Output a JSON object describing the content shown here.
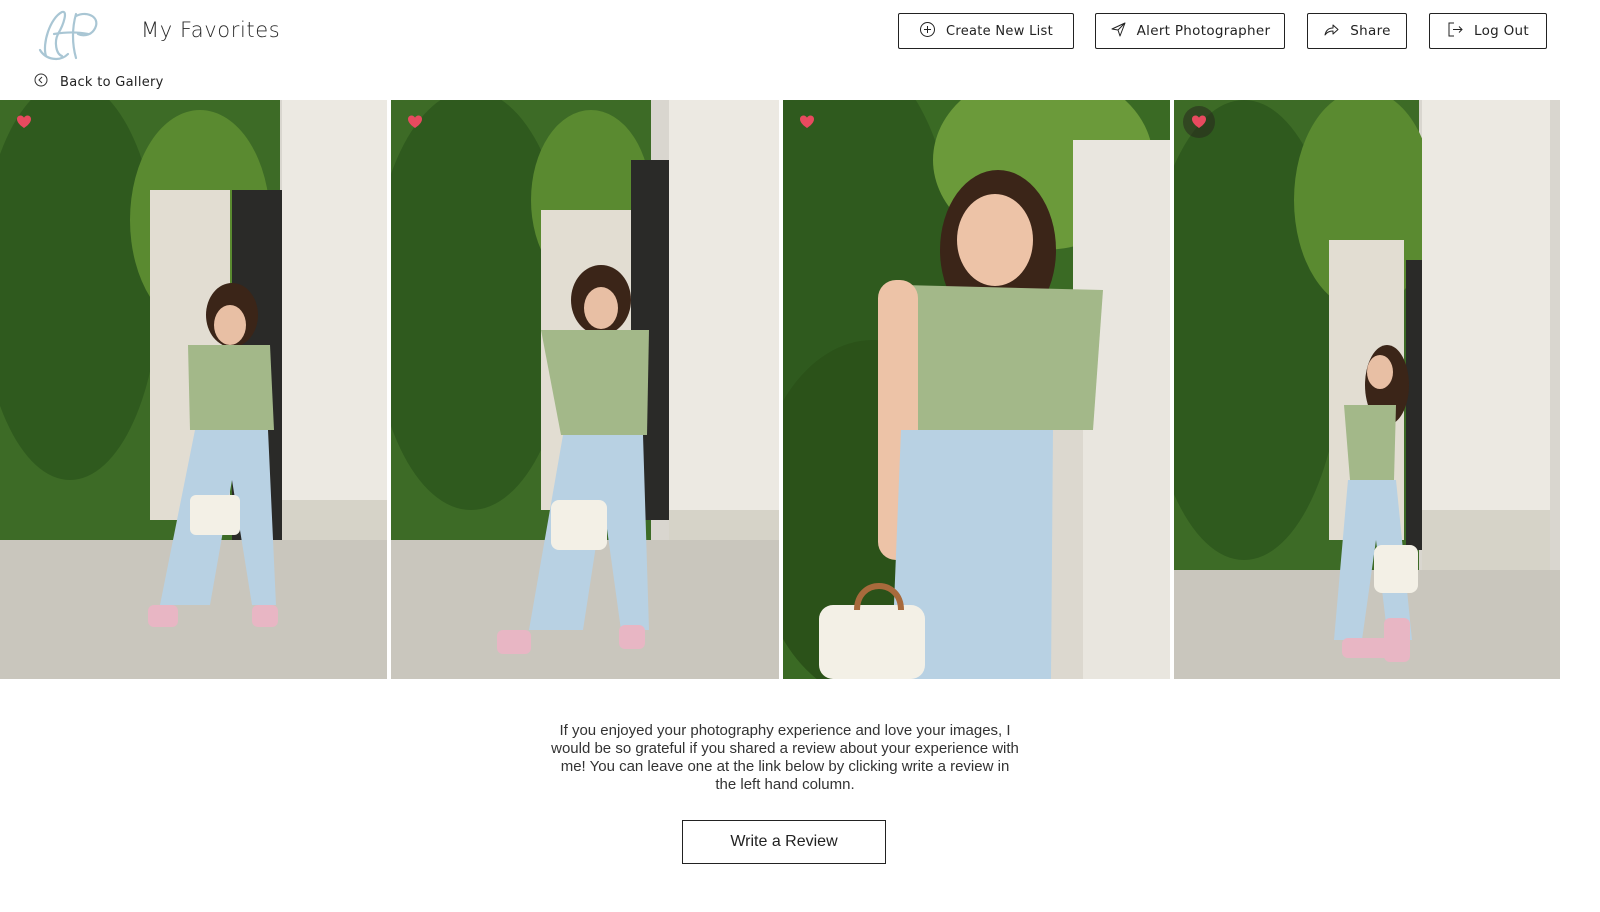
{
  "header": {
    "title": "My Favorites",
    "back_label": "Back to Gallery",
    "buttons": {
      "create_list": "Create New List",
      "alert_photographer": "Alert Photographer",
      "share": "Share",
      "logout": "Log Out"
    }
  },
  "gallery": {
    "photos": [
      {
        "favorited": true,
        "icon": "heart-icon"
      },
      {
        "favorited": true,
        "icon": "heart-icon"
      },
      {
        "favorited": true,
        "icon": "heart-icon"
      },
      {
        "favorited": true,
        "icon": "heart-icon"
      }
    ]
  },
  "review": {
    "text": "If you enjoyed your photography experience and love your images, I would be so grateful if you shared a review about your experience with me! You can leave one at the link below by clicking write a review in the left hand column.",
    "button_label": "Write a Review"
  },
  "colors": {
    "heart": "#e84a5f",
    "logo": "#a9c6d4",
    "ivy_dark": "#2f5a1e",
    "ivy_light": "#6b9a3a",
    "wall": "#e9e6df",
    "sweater": "#a3b889",
    "jeans": "#b8d1e3"
  }
}
